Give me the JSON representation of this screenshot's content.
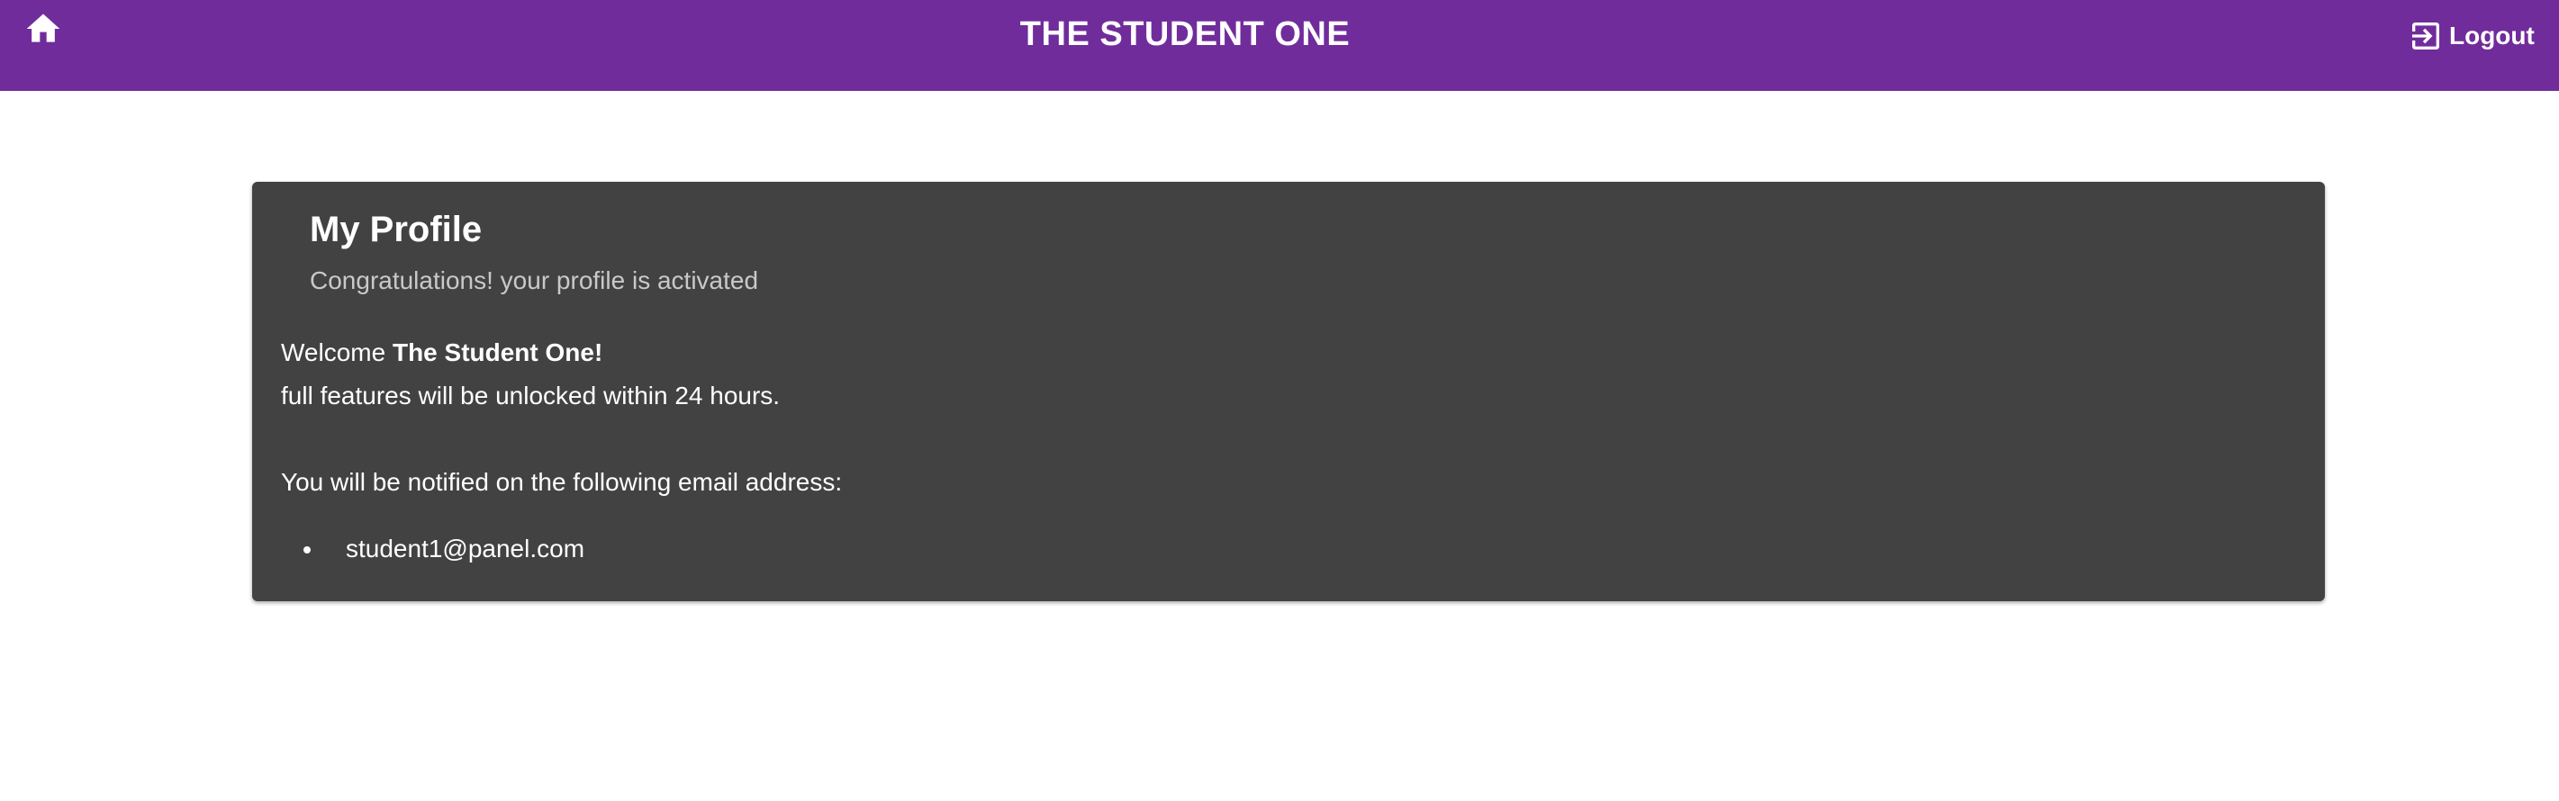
{
  "header": {
    "title": "THE STUDENT ONE",
    "home_icon": "home-icon",
    "logout_icon": "exit-to-app-icon",
    "logout_label": "Logout",
    "background_color": "#712c9c"
  },
  "profile_card": {
    "title": "My Profile",
    "subtitle": "Congratulations! your profile is activated",
    "welcome_prefix": "Welcome ",
    "welcome_name": "The Student One!",
    "unlock_message": "full features will be unlocked within 24 hours.",
    "notify_message": "You will be notified on the following email address:",
    "emails": [
      "student1@panel.com"
    ],
    "background_color": "#424242"
  }
}
